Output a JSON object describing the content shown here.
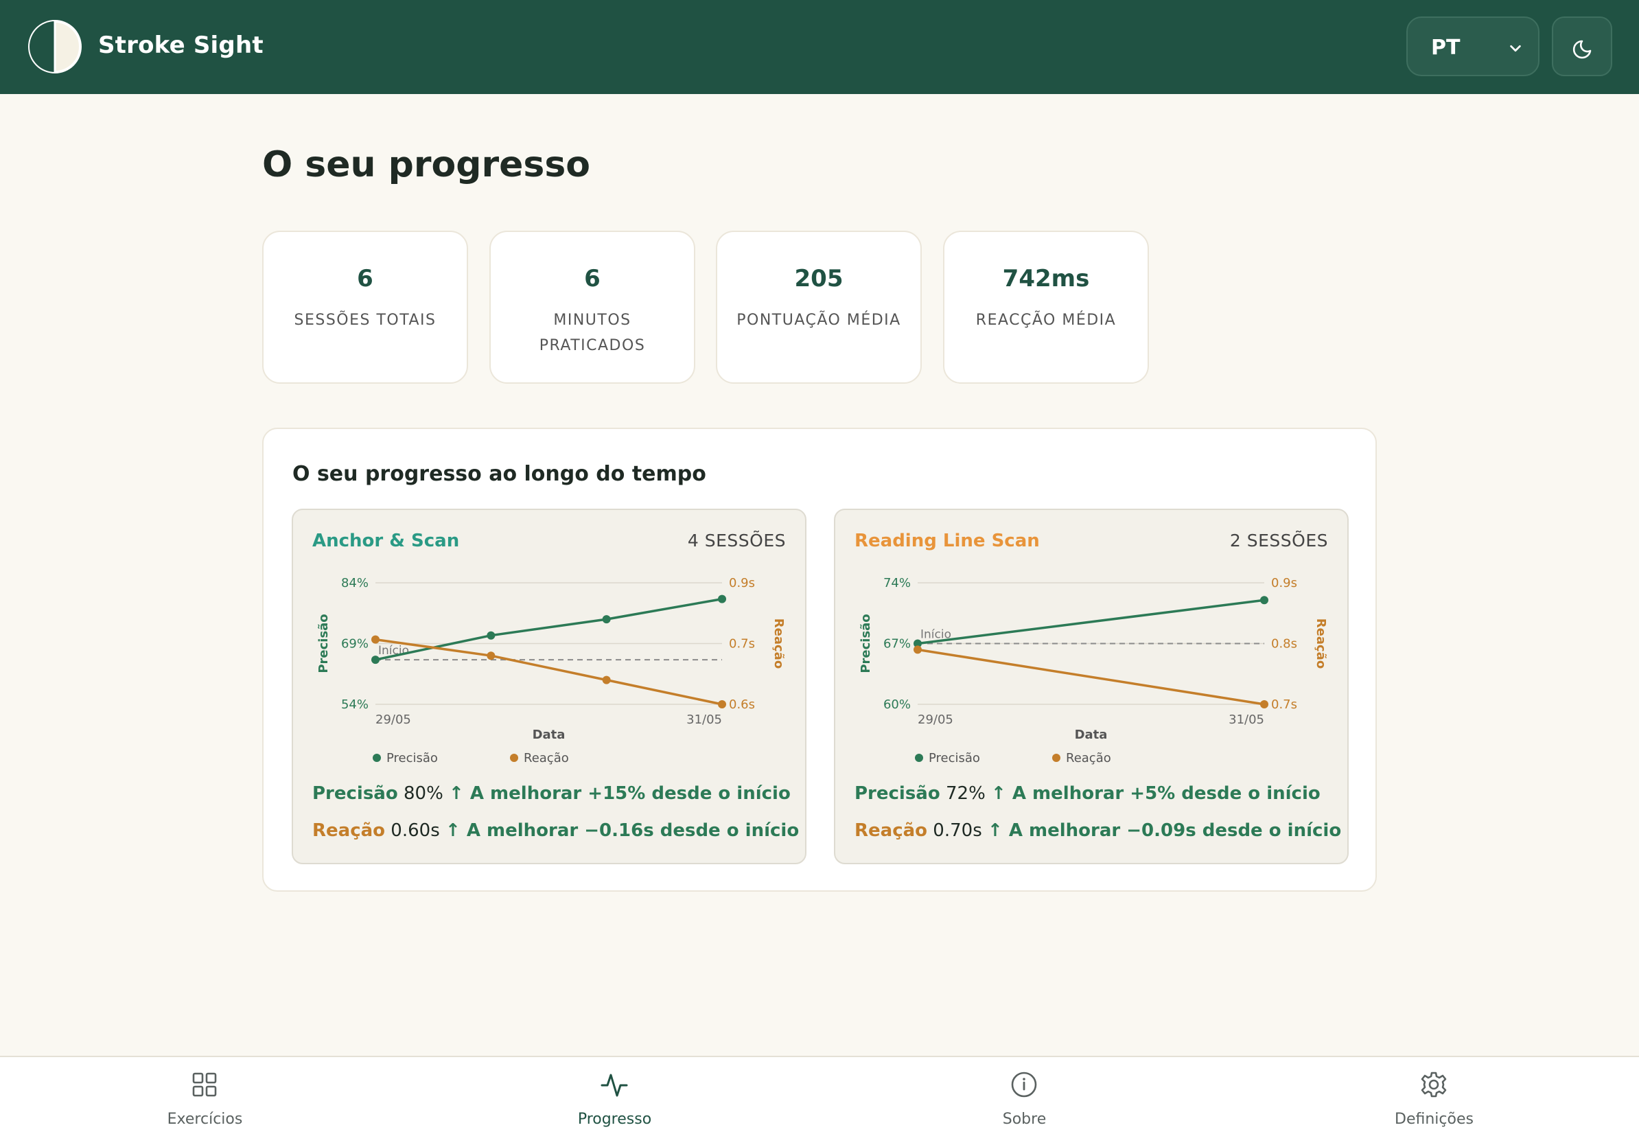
{
  "app": {
    "name": "Stroke Sight"
  },
  "header": {
    "language": "PT",
    "language_options": [
      "PT"
    ],
    "theme_toggle_icon": "moon-icon"
  },
  "page": {
    "title": "O seu progresso"
  },
  "stats": [
    {
      "value": "6",
      "label": "SESSÕES TOTAIS"
    },
    {
      "value": "6",
      "label": "MINUTOS PRATICADOS"
    },
    {
      "value": "205",
      "label": "PONTUAÇÃO MÉDIA"
    },
    {
      "value": "742ms",
      "label": "REACÇÃO MÉDIA"
    }
  ],
  "progress": {
    "title": "O seu progresso ao longo do tempo",
    "exercises": [
      {
        "name": "Anchor & Scan",
        "title_color": "#2a9a85",
        "sessions": "4 SESSÕES",
        "summary": {
          "precision_label": "Precisão",
          "precision_value": "80%",
          "precision_trend": "↑ A melhorar +15% desde o início",
          "reaction_label": "Reação",
          "reaction_value": "0.60s",
          "reaction_trend": "↑ A melhorar −0.16s desde o início"
        }
      },
      {
        "name": "Reading Line Scan",
        "title_color": "#e8943a",
        "sessions": "2 SESSÕES",
        "summary": {
          "precision_label": "Precisão",
          "precision_value": "72%",
          "precision_trend": "↑ A melhorar +5% desde o início",
          "reaction_label": "Reação",
          "reaction_value": "0.70s",
          "reaction_trend": "↑ A melhorar −0.09s desde o início"
        }
      }
    ]
  },
  "chart_data": [
    {
      "type": "line",
      "xlabel": "Data",
      "x_tick_labels": [
        "29/05",
        "31/05"
      ],
      "left_axis": {
        "label": "Precisão",
        "ticks": [
          "84%",
          "69%",
          "54%"
        ],
        "ylim": [
          54,
          84
        ],
        "color": "#2c7a56"
      },
      "right_axis": {
        "label": "Reação",
        "ticks": [
          "0.9s",
          "0.7s",
          "0.6s"
        ],
        "ylim": [
          0.6,
          0.9
        ],
        "color": "#c47e2a"
      },
      "baseline_label": "Início",
      "baseline_precision": 65,
      "series": [
        {
          "name": "Precisão",
          "axis": "left",
          "values": [
            65,
            71,
            75,
            80
          ]
        },
        {
          "name": "Reação",
          "axis": "right",
          "values": [
            0.76,
            0.72,
            0.66,
            0.6
          ]
        }
      ],
      "legend": [
        "Precisão",
        "Reação"
      ],
      "legend_position": "bottom"
    },
    {
      "type": "line",
      "xlabel": "Data",
      "x_tick_labels": [
        "29/05",
        "31/05"
      ],
      "left_axis": {
        "label": "Precisão",
        "ticks": [
          "74%",
          "67%",
          "60%"
        ],
        "ylim": [
          60,
          74
        ],
        "color": "#2c7a56"
      },
      "right_axis": {
        "label": "Reação",
        "ticks": [
          "0.9s",
          "0.8s",
          "0.7s"
        ],
        "ylim": [
          0.7,
          0.9
        ],
        "color": "#c47e2a"
      },
      "baseline_label": "Início",
      "baseline_precision": 67,
      "series": [
        {
          "name": "Precisão",
          "axis": "left",
          "values": [
            67,
            72
          ]
        },
        {
          "name": "Reação",
          "axis": "right",
          "values": [
            0.79,
            0.7
          ]
        }
      ],
      "legend": [
        "Precisão",
        "Reação"
      ],
      "legend_position": "bottom"
    }
  ],
  "nav": [
    {
      "label": "Exercícios",
      "icon": "grid-icon"
    },
    {
      "label": "Progresso",
      "icon": "activity-icon"
    },
    {
      "label": "Sobre",
      "icon": "info-icon"
    },
    {
      "label": "Definições",
      "icon": "gear-icon"
    }
  ],
  "colors": {
    "brand": "#205243",
    "precision": "#2c7a56",
    "reaction": "#c47e2a",
    "background": "#faf8f2"
  }
}
